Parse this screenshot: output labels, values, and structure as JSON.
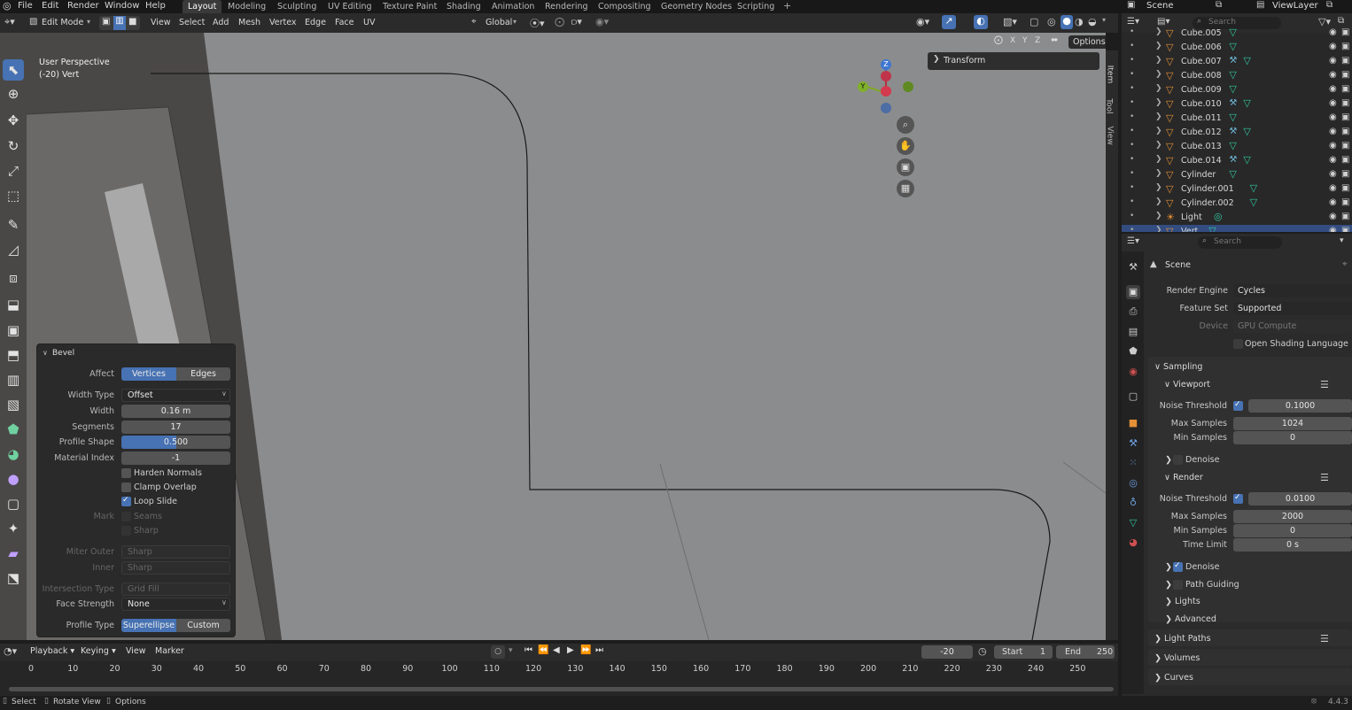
{
  "menu": [
    "File",
    "Edit",
    "Render",
    "Window",
    "Help"
  ],
  "workspaces": [
    "Layout",
    "Modeling",
    "Sculpting",
    "UV Editing",
    "Texture Paint",
    "Shading",
    "Animation",
    "Rendering",
    "Compositing",
    "Geometry Nodes",
    "Scripting"
  ],
  "scene_name": "Scene",
  "view_layer": "ViewLayer",
  "viewport_header": {
    "mode": "Edit Mode",
    "menus": [
      "View",
      "Select",
      "Add",
      "Mesh",
      "Vertex",
      "Edge",
      "Face",
      "UV"
    ],
    "orientation": "Global",
    "options": "Options",
    "axes": [
      "X",
      "Y",
      "Z"
    ]
  },
  "overlay": {
    "line1": "User Perspective",
    "line2": "(-20) Vert"
  },
  "transform_panel": "Transform",
  "side_tabs": [
    "Item",
    "Tool",
    "View"
  ],
  "gizmo": {
    "z": "Z",
    "y": "Y"
  },
  "bevel": {
    "title": "Bevel",
    "affect_label": "Affect",
    "affect_options": [
      "Vertices",
      "Edges"
    ],
    "width_type_label": "Width Type",
    "width_type": "Offset",
    "width_label": "Width",
    "width": "0.16 m",
    "segments_label": "Segments",
    "segments": "17",
    "profile_shape_label": "Profile Shape",
    "profile_shape": "0.500",
    "profile_shape_fraction": 0.5,
    "material_index_label": "Material Index",
    "material_index": "-1",
    "harden_normals": "Harden Normals",
    "clamp_overlap": "Clamp Overlap",
    "loop_slide": "Loop Slide",
    "mark_label": "Mark",
    "seams": "Seams",
    "sharp": "Sharp",
    "miter_outer_label": "Miter Outer",
    "miter_outer": "Sharp",
    "inner_label": "Inner",
    "inner": "Sharp",
    "intersection_label": "Intersection Type",
    "intersection": "Grid Fill",
    "face_strength_label": "Face Strength",
    "face_strength": "None",
    "profile_type_label": "Profile Type",
    "profile_types": [
      "Superellipse",
      "Custom"
    ]
  },
  "timeline": {
    "menus": [
      "Playback",
      "Keying",
      "View",
      "Marker"
    ],
    "current_frame": "-20",
    "start_label": "Start",
    "start": "1",
    "end_label": "End",
    "end": "250",
    "ticks": [
      "0",
      "10",
      "20",
      "30",
      "40",
      "50",
      "60",
      "70",
      "80",
      "90",
      "100",
      "110",
      "120",
      "130",
      "140",
      "150",
      "160",
      "170",
      "180",
      "190",
      "200",
      "210",
      "220",
      "230",
      "240",
      "250"
    ]
  },
  "status": {
    "select": "Select",
    "rotate": "Rotate View",
    "options": "Options",
    "version": "4.4.3"
  },
  "outliner": {
    "search": "Search",
    "items": [
      {
        "name": "Cube.005",
        "modifier": false
      },
      {
        "name": "Cube.006",
        "modifier": false
      },
      {
        "name": "Cube.007",
        "modifier": true
      },
      {
        "name": "Cube.008",
        "modifier": false
      },
      {
        "name": "Cube.009",
        "modifier": false
      },
      {
        "name": "Cube.010",
        "modifier": true
      },
      {
        "name": "Cube.011",
        "modifier": false
      },
      {
        "name": "Cube.012",
        "modifier": true
      },
      {
        "name": "Cube.013",
        "modifier": false
      },
      {
        "name": "Cube.014",
        "modifier": true
      },
      {
        "name": "Cylinder",
        "modifier": false
      },
      {
        "name": "Cylinder.001",
        "modifier": false
      },
      {
        "name": "Cylinder.002",
        "modifier": false
      },
      {
        "name": "Light",
        "modifier": false
      },
      {
        "name": "Vert",
        "modifier": false
      }
    ]
  },
  "properties": {
    "search": "Search",
    "context": "Scene",
    "render_engine_label": "Render Engine",
    "render_engine": "Cycles",
    "feature_set_label": "Feature Set",
    "feature_set": "Supported",
    "device_label": "Device",
    "device": "GPU Compute",
    "osl": "Open Shading Language",
    "sampling": "Sampling",
    "viewport": "Viewport",
    "noise_threshold_label": "Noise Threshold",
    "vp_noise": "0.1000",
    "max_samples_label": "Max Samples",
    "vp_max": "1024",
    "min_samples_label": "Min Samples",
    "vp_min": "0",
    "denoise": "Denoise",
    "render": "Render",
    "r_noise": "0.0100",
    "r_max": "2000",
    "r_min": "0",
    "time_limit_label": "Time Limit",
    "r_time": "0 s",
    "path_guiding": "Path Guiding",
    "lights": "Lights",
    "advanced": "Advanced",
    "light_paths": "Light Paths",
    "volumes": "Volumes",
    "curves": "Curves"
  }
}
